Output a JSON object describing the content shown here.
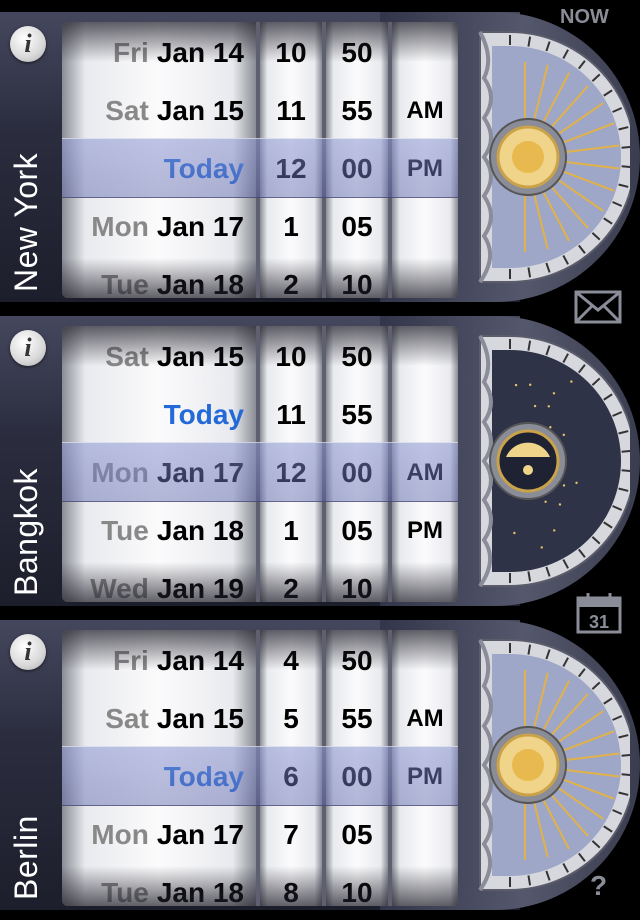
{
  "now_label": "NOW",
  "help_label": "?",
  "info_label": "i",
  "calendar_day": "31",
  "panels": [
    {
      "city": "New York",
      "dates": [
        {
          "dow": "Fri",
          "date": "Jan 14"
        },
        {
          "dow": "Sat",
          "date": "Jan 15"
        },
        {
          "dow": "",
          "date": "Today"
        },
        {
          "dow": "Mon",
          "date": "Jan 17"
        },
        {
          "dow": "Tue",
          "date": "Jan 18"
        }
      ],
      "hours": [
        "10",
        "11",
        "12",
        "1",
        "2"
      ],
      "minutes": [
        "50",
        "55",
        "00",
        "05",
        "10"
      ],
      "ampm": [
        "",
        "AM",
        "PM",
        "",
        ""
      ]
    },
    {
      "city": "Bangkok",
      "dates": [
        {
          "dow": "Sat",
          "date": "Jan 15"
        },
        {
          "dow": "",
          "date": "Today"
        },
        {
          "dow": "Mon",
          "date": "Jan 17"
        },
        {
          "dow": "Tue",
          "date": "Jan 18"
        },
        {
          "dow": "Wed",
          "date": "Jan 19"
        }
      ],
      "hours": [
        "10",
        "11",
        "12",
        "1",
        "2"
      ],
      "minutes": [
        "50",
        "55",
        "00",
        "05",
        "10"
      ],
      "ampm": [
        "",
        "",
        "AM",
        "PM",
        ""
      ]
    },
    {
      "city": "Berlin",
      "dates": [
        {
          "dow": "Fri",
          "date": "Jan 14"
        },
        {
          "dow": "Sat",
          "date": "Jan 15"
        },
        {
          "dow": "",
          "date": "Today"
        },
        {
          "dow": "Mon",
          "date": "Jan 17"
        },
        {
          "dow": "Tue",
          "date": "Jan 18"
        }
      ],
      "hours": [
        "4",
        "5",
        "6",
        "7",
        "8"
      ],
      "minutes": [
        "50",
        "55",
        "00",
        "05",
        "10"
      ],
      "ampm": [
        "",
        "AM",
        "PM",
        "",
        ""
      ]
    }
  ],
  "icons": {
    "info": "info-icon",
    "mail": "mail-icon",
    "calendar": "calendar-icon",
    "sun": "sun-dial-icon",
    "moon": "moon-dial-icon"
  },
  "colors": {
    "today": "#2369d8",
    "selection_band": "#8c96d2",
    "panel": "#2b2d3f"
  }
}
